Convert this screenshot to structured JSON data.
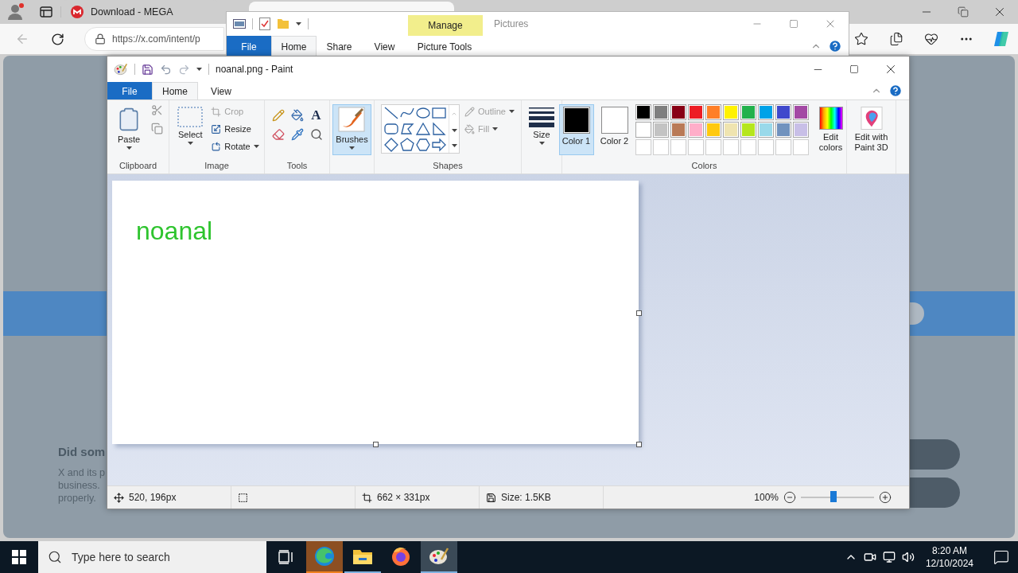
{
  "browser": {
    "tabs": [
      {
        "title": "Download - MEGA",
        "selected": false
      },
      {
        "selected": true
      }
    ],
    "address": "https://x.com/intent/p",
    "page": {
      "heading": "Did som",
      "lines": [
        "X and its p",
        "business.",
        "properly."
      ]
    }
  },
  "explorer": {
    "title": "Pictures",
    "context_tab": "Manage",
    "context_label": "Picture Tools",
    "tabs": [
      {
        "label": "File",
        "kind": "file",
        "selected": false
      },
      {
        "label": "Home",
        "kind": "tab",
        "selected": true
      },
      {
        "label": "Share",
        "kind": "tab",
        "selected": false
      },
      {
        "label": "View",
        "kind": "tab",
        "selected": false
      }
    ]
  },
  "paint": {
    "title": "noanal.png - Paint",
    "tabs": [
      {
        "label": "File",
        "kind": "file",
        "selected": false
      },
      {
        "label": "Home",
        "kind": "tab",
        "selected": true
      },
      {
        "label": "View",
        "kind": "tab",
        "selected": false
      }
    ],
    "ribbon": {
      "clipboard": {
        "label": "Clipboard",
        "paste": "Paste"
      },
      "image": {
        "label": "Image",
        "select": "Select",
        "actions": [
          {
            "label": "Crop",
            "disabled": true,
            "dropdown": false
          },
          {
            "label": "Resize",
            "disabled": false,
            "dropdown": false
          },
          {
            "label": "Rotate",
            "disabled": false,
            "dropdown": true
          }
        ]
      },
      "tools": {
        "label": "Tools",
        "text_tool": "A"
      },
      "brushes": {
        "label": "Brushes",
        "selected": true
      },
      "shapes": {
        "label": "Shapes",
        "options": [
          {
            "label": "Outline",
            "disabled": true,
            "dropdown": true
          },
          {
            "label": "Fill",
            "disabled": true,
            "dropdown": true
          }
        ]
      },
      "size": {
        "label": "Size"
      },
      "colors": {
        "label": "Colors",
        "slots": [
          {
            "label": "Color 1",
            "color": "#000000",
            "selected": true
          },
          {
            "label": "Color 2",
            "color": "#ffffff",
            "selected": false
          }
        ],
        "palette": [
          {
            "kind": "swatch",
            "color": "#000000"
          },
          {
            "kind": "swatch",
            "color": "#7f7f7f"
          },
          {
            "kind": "swatch",
            "color": "#880015"
          },
          {
            "kind": "swatch",
            "color": "#ed1c24"
          },
          {
            "kind": "swatch",
            "color": "#ff7f27"
          },
          {
            "kind": "swatch",
            "color": "#fff200"
          },
          {
            "kind": "swatch",
            "color": "#22b14c"
          },
          {
            "kind": "swatch",
            "color": "#00a2e8"
          },
          {
            "kind": "swatch",
            "color": "#3f48cc"
          },
          {
            "kind": "swatch",
            "color": "#a349a4"
          },
          {
            "kind": "swatch",
            "color": "#ffffff"
          },
          {
            "kind": "swatch",
            "color": "#c3c3c3"
          },
          {
            "kind": "swatch",
            "color": "#b97a57"
          },
          {
            "kind": "swatch",
            "color": "#ffaec9"
          },
          {
            "kind": "swatch",
            "color": "#ffc90e"
          },
          {
            "kind": "swatch",
            "color": "#efe4b0"
          },
          {
            "kind": "swatch",
            "color": "#b5e61d"
          },
          {
            "kind": "swatch",
            "color": "#99d9ea"
          },
          {
            "kind": "swatch",
            "color": "#7092be"
          },
          {
            "kind": "swatch",
            "color": "#c8bfe7"
          },
          {
            "kind": "empty"
          },
          {
            "kind": "empty"
          },
          {
            "kind": "empty"
          },
          {
            "kind": "empty"
          },
          {
            "kind": "empty"
          },
          {
            "kind": "empty"
          },
          {
            "kind": "empty"
          },
          {
            "kind": "empty"
          },
          {
            "kind": "empty"
          },
          {
            "kind": "empty"
          }
        ],
        "edit": "Edit colors"
      },
      "paint3d": {
        "label": "Edit with Paint 3D"
      }
    },
    "canvas": {
      "text": "noanal"
    },
    "status": {
      "position": "520, 196px",
      "dimensions": "662 × 331px",
      "size": "Size: 1.5KB",
      "zoom": "100%",
      "level": 0.45
    }
  },
  "taskbar": {
    "search_placeholder": "Type here to search",
    "apps": [
      {
        "kind": "browser",
        "open": true,
        "active": false,
        "flashing": true
      },
      {
        "kind": "folder",
        "open": true,
        "active": false,
        "flashing": false
      },
      {
        "kind": "firefox",
        "open": false,
        "active": false,
        "flashing": false
      },
      {
        "kind": "paint",
        "open": true,
        "active": true,
        "flashing": false
      }
    ],
    "time": "8:20 AM",
    "date": "12/10/2024"
  }
}
